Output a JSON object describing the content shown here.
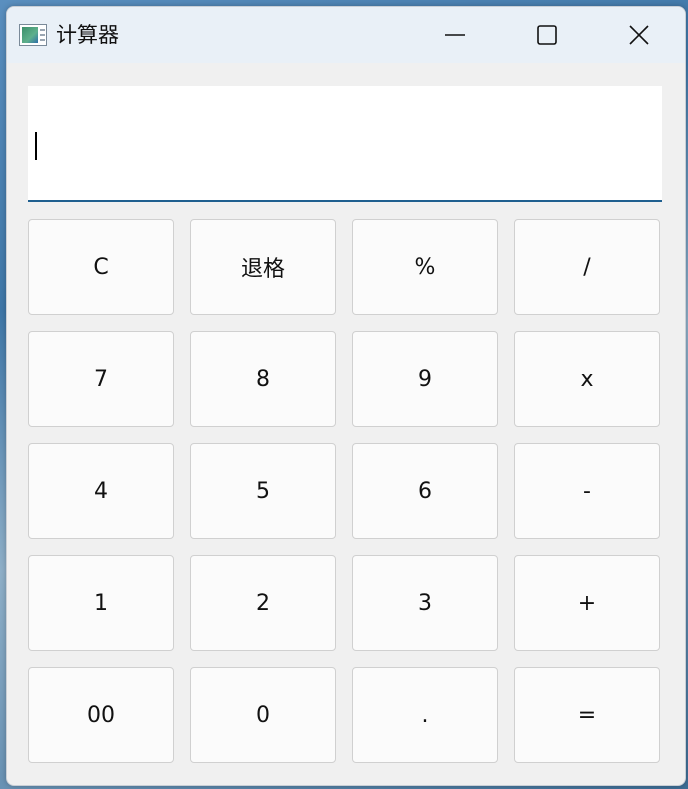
{
  "window": {
    "title": "计算器",
    "icon": "calculator-app-icon",
    "controls": {
      "minimize_icon": "minimize-icon",
      "maximize_icon": "maximize-icon",
      "close_icon": "close-icon"
    }
  },
  "display": {
    "value": ""
  },
  "keys": {
    "row1": [
      "C",
      "退格",
      "%",
      "/"
    ],
    "row2": [
      "7",
      "8",
      "9",
      "x"
    ],
    "row3": [
      "4",
      "5",
      "6",
      "-"
    ],
    "row4": [
      "1",
      "2",
      "3",
      "+"
    ],
    "row5": [
      "00",
      "0",
      ".",
      "="
    ]
  },
  "colors": {
    "titlebar": "#e9f0f7",
    "window_bg": "#f0f0f0",
    "key_bg": "#fbfbfb",
    "display_accent": "#1f5f8f"
  }
}
